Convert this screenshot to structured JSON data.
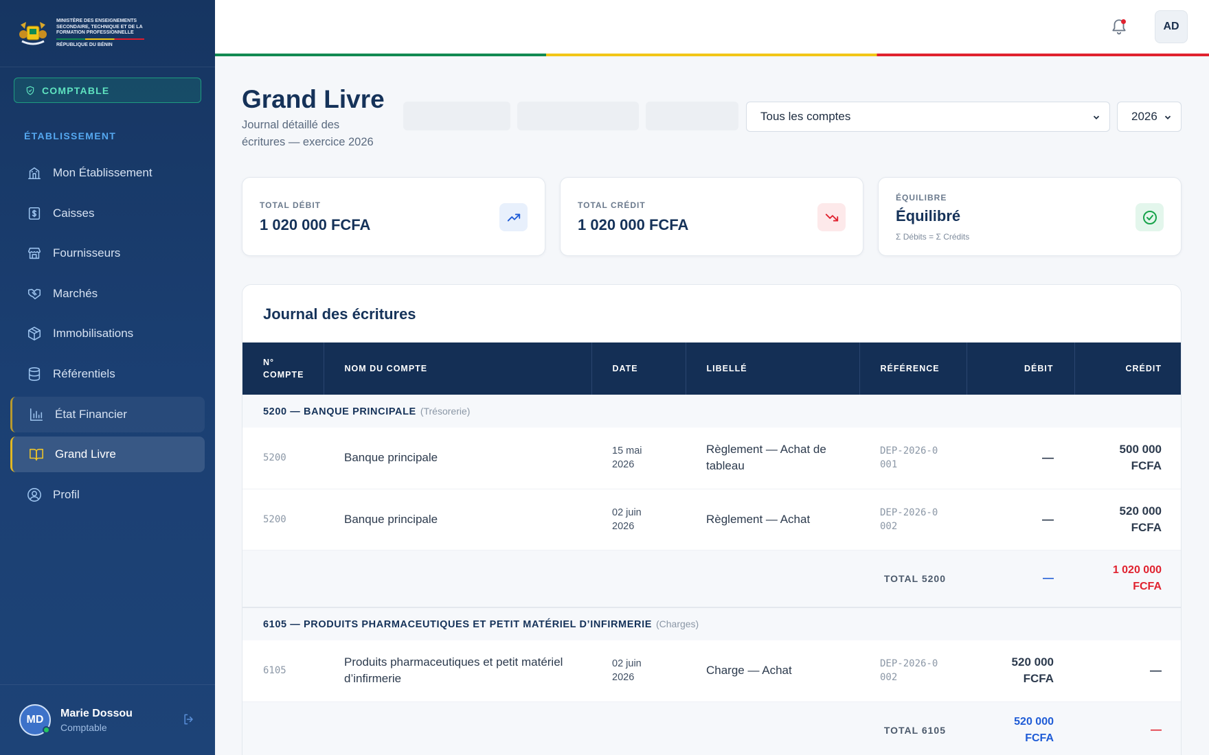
{
  "brand": {
    "ministry": "MINISTÈRE DES ENSEIGNEMENTS SECONDAIRE, TECHNIQUE ET DE LA FORMATION PROFESSIONNELLE",
    "country": "RÉPUBLIQUE DU BÉNIN"
  },
  "sidebar": {
    "role": "COMPTABLE",
    "section": "ÉTABLISSEMENT",
    "items": [
      {
        "label": "Mon Établissement",
        "icon": "building-icon"
      },
      {
        "label": "Caisses",
        "icon": "cash-register-icon"
      },
      {
        "label": "Fournisseurs",
        "icon": "store-icon"
      },
      {
        "label": "Marchés",
        "icon": "handshake-icon"
      },
      {
        "label": "Immobilisations",
        "icon": "package-icon"
      },
      {
        "label": "Référentiels",
        "icon": "database-icon"
      },
      {
        "label": "État Financier",
        "icon": "bar-chart-icon"
      },
      {
        "label": "Grand Livre",
        "icon": "book-open-icon",
        "active": true
      },
      {
        "label": "Profil",
        "icon": "user-circle-icon"
      }
    ],
    "user": {
      "initials": "MD",
      "name": "Marie Dossou",
      "role": "Comptable"
    }
  },
  "topbar": {
    "avatar": "AD"
  },
  "colors": {
    "primary": "#153259",
    "accent": "#e2b823",
    "debit": "#1e5bd6",
    "credit": "#e0222f",
    "flag_green": "#128a52",
    "flag_yellow": "#f2c617",
    "flag_red": "#e0222f"
  },
  "header": {
    "title": "Grand Livre",
    "subtitle": "Journal détaillé des écritures — exercice 2026",
    "account_filter": "Tous les comptes",
    "year_filter": "2026"
  },
  "kpis": {
    "debit": {
      "label": "TOTAL DÉBIT",
      "value": "1 020 000 FCFA"
    },
    "credit": {
      "label": "TOTAL CRÉDIT",
      "value": "1 020 000 FCFA"
    },
    "balance": {
      "label": "ÉQUILIBRE",
      "value": "Équilibré",
      "note": "Σ Débits = Σ Crédits"
    }
  },
  "journal": {
    "title": "Journal des écritures",
    "columns": {
      "account_no": "N° COMPTE",
      "account_name": "NOM DU COMPTE",
      "date": "DATE",
      "label": "LIBELLÉ",
      "reference": "RÉFÉRENCE",
      "debit": "DÉBIT",
      "credit": "CRÉDIT"
    },
    "groups": [
      {
        "title": "5200 — BANQUE PRINCIPALE",
        "category": "(Trésorerie)",
        "rows": [
          {
            "account": "5200",
            "name": "Banque principale",
            "date": "15 mai 2026",
            "label": "Règlement — Achat de tableau",
            "ref": "DEP-2026-0001",
            "debit": "—",
            "credit": "500 000 FCFA"
          },
          {
            "account": "5200",
            "name": "Banque principale",
            "date": "02 juin 2026",
            "label": "Règlement — Achat",
            "ref": "DEP-2026-0002",
            "debit": "—",
            "credit": "520 000 FCFA"
          }
        ],
        "total": {
          "label": "TOTAL 5200",
          "debit": "—",
          "credit": "1 020 000 FCFA"
        }
      },
      {
        "title": "6105 — PRODUITS PHARMACEUTIQUES ET PETIT MATÉRIEL D’INFIRMERIE",
        "category": "(Charges)",
        "rows": [
          {
            "account": "6105",
            "name": "Produits pharmaceutiques et petit matériel d’infirmerie",
            "date": "02 juin 2026",
            "label": "Charge — Achat",
            "ref": "DEP-2026-0002",
            "debit": "520 000 FCFA",
            "credit": "—"
          }
        ],
        "total": {
          "label": "TOTAL 6105",
          "debit": "520 000 FCFA",
          "credit": "—"
        }
      }
    ]
  }
}
